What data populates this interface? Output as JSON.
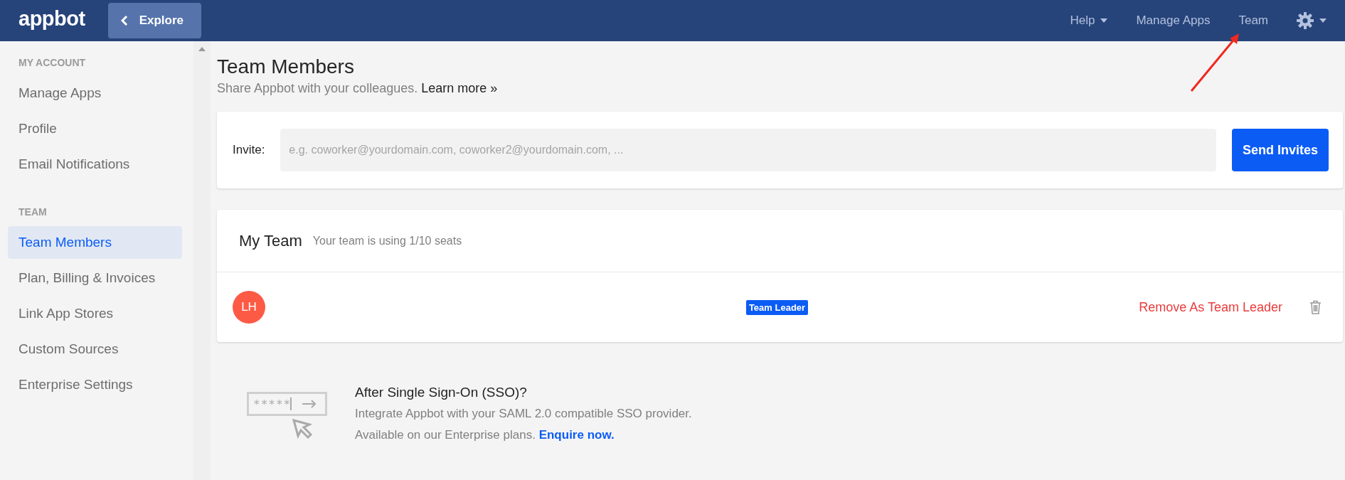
{
  "topbar": {
    "logo": "appbot",
    "back_button": "Explore",
    "nav": [
      {
        "label": "Help",
        "kind": "dropdown"
      },
      {
        "label": "Manage Apps",
        "kind": "link"
      },
      {
        "label": "Team",
        "kind": "link"
      }
    ]
  },
  "sidebar": {
    "sections": [
      {
        "heading": "MY ACCOUNT",
        "items": [
          {
            "label": "Manage Apps",
            "selected": false
          },
          {
            "label": "Profile",
            "selected": false
          },
          {
            "label": "Email Notifications",
            "selected": false
          }
        ]
      },
      {
        "heading": "TEAM",
        "items": [
          {
            "label": "Team Members",
            "selected": true
          },
          {
            "label": "Plan, Billing & Invoices",
            "selected": false
          },
          {
            "label": "Link App Stores",
            "selected": false
          },
          {
            "label": "Custom Sources",
            "selected": false
          },
          {
            "label": "Enterprise Settings",
            "selected": false
          }
        ]
      }
    ]
  },
  "page": {
    "title": "Team Members",
    "subtitle": "Share Appbot with your colleagues.",
    "learn_more": "Learn more »"
  },
  "invite": {
    "label": "Invite:",
    "placeholder": "e.g. coworker@yourdomain.com, coworker2@yourdomain.com, ...",
    "button": "Send Invites"
  },
  "team": {
    "title": "My Team",
    "seats": "Your team is using 1/10 seats",
    "members": [
      {
        "initials": "LH",
        "color": "#fd5a45",
        "badge": "Team Leader",
        "action": "Remove As Team Leader"
      }
    ]
  },
  "sso": {
    "heading": "After Single Sign-On (SSO)?",
    "text": "Integrate Appbot with your SAML 2.0 compatible SSO provider. Available on our Enterprise plans.",
    "link": "Enquire now.",
    "icon_text": "*****"
  }
}
